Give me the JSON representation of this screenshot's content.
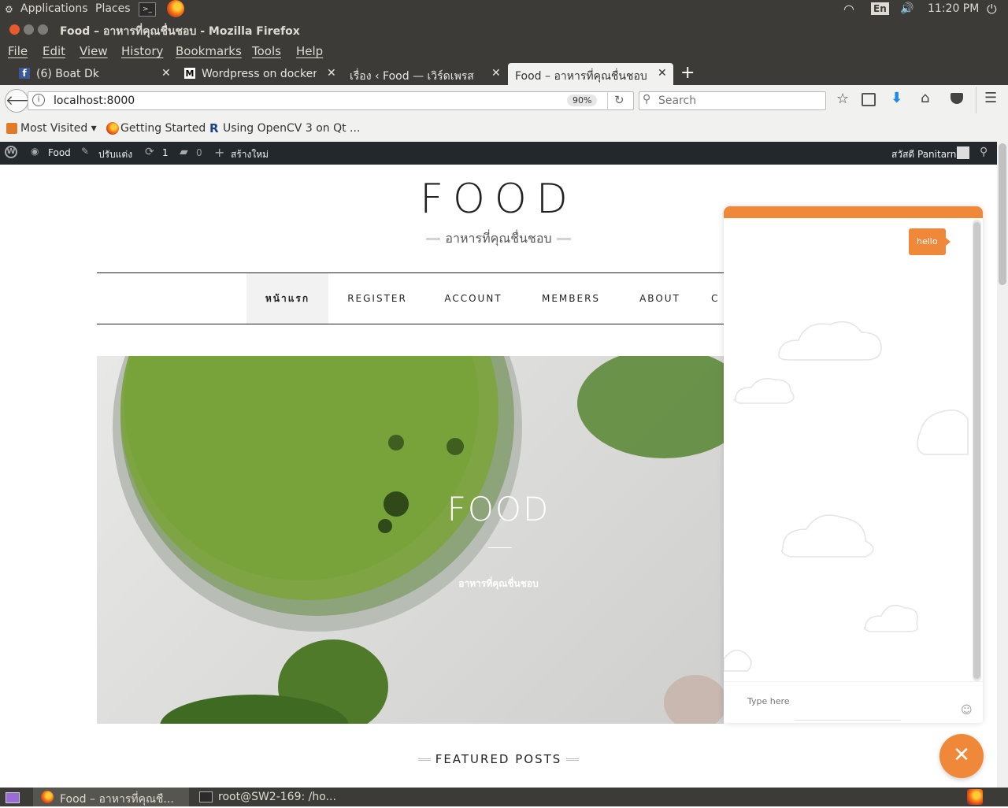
{
  "top_panel": {
    "applications": "Applications",
    "places": "Places",
    "keyboard": "En",
    "clock": "11:20 PM"
  },
  "window": {
    "title": "Food – อาหารที่คุณชื่นชอบ - Mozilla Firefox"
  },
  "menu": [
    "File",
    "Edit",
    "View",
    "History",
    "Bookmarks",
    "Tools",
    "Help"
  ],
  "tabs": [
    {
      "label": "(6) Boat Dk",
      "icon": "facebook-icon"
    },
    {
      "label": "Wordpress on docker ·",
      "icon": "medium-icon"
    },
    {
      "label": "เรื่อง ‹ Food — เวิร์ดเพรส",
      "icon": "none"
    },
    {
      "label": "Food – อาหารที่คุณชื่นชอบ",
      "icon": "none",
      "active": true
    }
  ],
  "navbar": {
    "url": "localhost:8000",
    "zoom": "90%",
    "search_placeholder": "Search"
  },
  "bookmarks": [
    {
      "label": "Most Visited ▾",
      "icon": "rss-icon"
    },
    {
      "label": "Getting Started",
      "icon": "firefox-icon"
    },
    {
      "label": "Using OpenCV 3 on Qt ...",
      "icon": "r-icon"
    }
  ],
  "wp_admin": {
    "site": "Food",
    "customize": "ปรับแต่ง",
    "updates": "1",
    "comments": "0",
    "new": "สร้างใหม่",
    "greeting": "สวัสดี Panitarn"
  },
  "site": {
    "title": "FOOD",
    "tagline": "อาหารที่คุณชื่นชอบ",
    "nav": [
      "หน้าแรก",
      "REGISTER",
      "ACCOUNT",
      "MEMBERS",
      "ABOUT",
      "C"
    ],
    "hero_title": "FOOD",
    "hero_subtitle": "อาหารที่คุณชื่นชอบ",
    "featured": "FEATURED POSTS"
  },
  "chat": {
    "message": "hello",
    "input_placeholder": "Type here",
    "accent": "#f0883a"
  },
  "taskbar": [
    {
      "label": "Food – อาหารที่คุณชื..."
    },
    {
      "label": "root@SW2-169: /ho..."
    }
  ]
}
